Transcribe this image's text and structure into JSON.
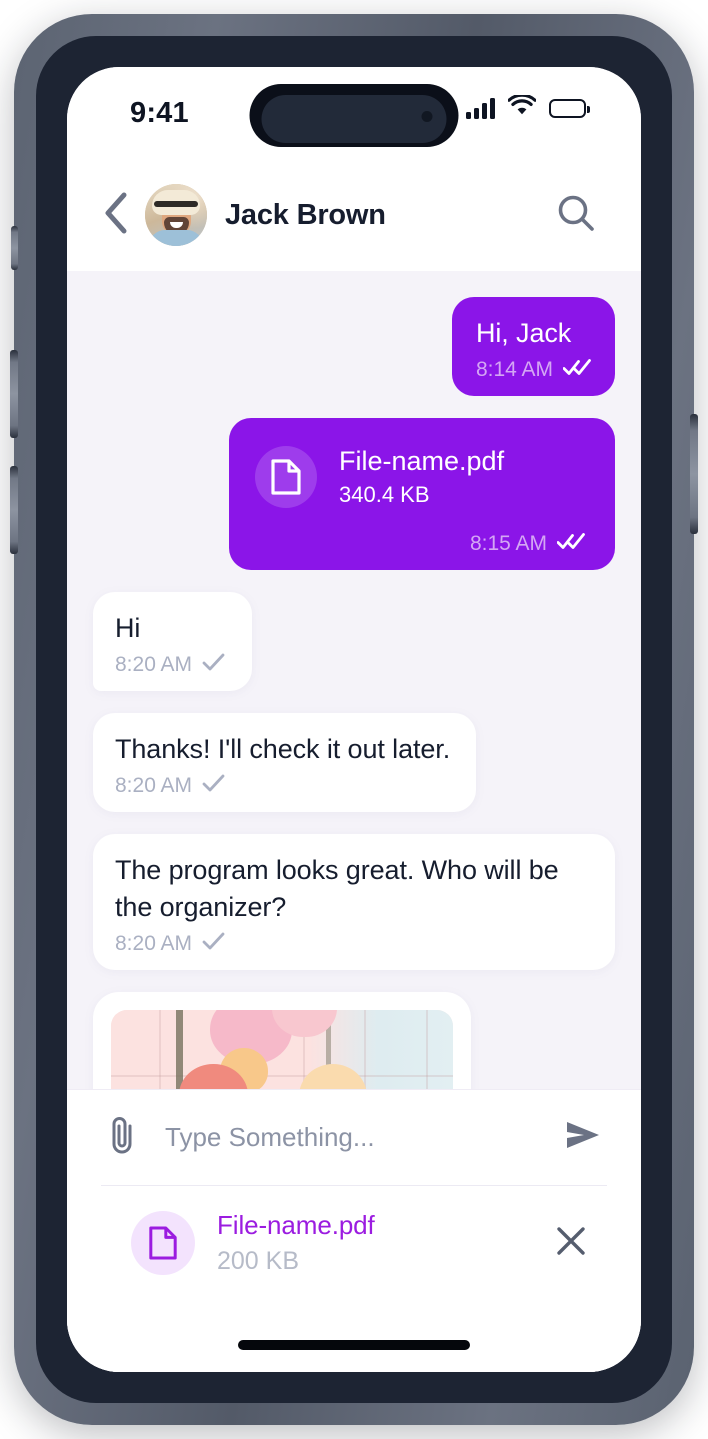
{
  "status_bar": {
    "time": "9:41",
    "signal_icon": "cellular-signal-icon",
    "wifi_icon": "wifi-icon",
    "battery_icon": "battery-full-icon"
  },
  "header": {
    "back_icon": "chevron-left-icon",
    "avatar_alt": "Jack Brown avatar",
    "title": "Jack Brown",
    "search_icon": "search-icon"
  },
  "messages": [
    {
      "id": "msg-hi-jack",
      "direction": "out",
      "type": "text",
      "text": "Hi, Jack",
      "time": "8:14 AM",
      "status": "read",
      "status_icon": "double-check-icon"
    },
    {
      "id": "msg-file-pdf",
      "direction": "out",
      "type": "file",
      "file_icon": "document-icon",
      "file_name": "File-name.pdf",
      "file_size": "340.4 KB",
      "time": "8:15 AM",
      "status": "read",
      "status_icon": "double-check-icon"
    },
    {
      "id": "msg-hi",
      "direction": "in",
      "type": "text",
      "text": "Hi",
      "time": "8:20 AM",
      "status": "sent",
      "status_icon": "single-check-icon"
    },
    {
      "id": "msg-thanks",
      "direction": "in",
      "type": "text",
      "text": "Thanks! I'll check it out later.",
      "time": "8:20 AM",
      "status": "sent",
      "status_icon": "single-check-icon"
    },
    {
      "id": "msg-program",
      "direction": "in",
      "type": "text",
      "text": "The program looks great. Who will be the organizer?",
      "time": "8:20 AM",
      "status": "sent",
      "status_icon": "single-check-icon"
    },
    {
      "id": "msg-photo",
      "direction": "in",
      "type": "image",
      "image_alt": "Pink and peach balloons floating against a pale pink wall"
    }
  ],
  "composer": {
    "attach_icon": "paperclip-icon",
    "input_value": "",
    "input_placeholder": "Type Something...",
    "send_icon": "send-icon"
  },
  "attachment": {
    "file_icon": "document-icon",
    "name": "File-name.pdf",
    "size": "200 KB",
    "remove_icon": "close-icon"
  },
  "colors": {
    "accent_purple": "#8B15E8",
    "attachment_purple": "#9B1CE0",
    "chat_background": "#F5F3F9",
    "incoming_bubble": "#FFFFFF",
    "text_dark": "#161D2E",
    "meta_gray": "#AAB0C2",
    "meta_purple": "#D4A6F4",
    "icon_slate": "#6B7284",
    "frame_metal": "#6B7281"
  },
  "home_indicator": "home-indicator"
}
